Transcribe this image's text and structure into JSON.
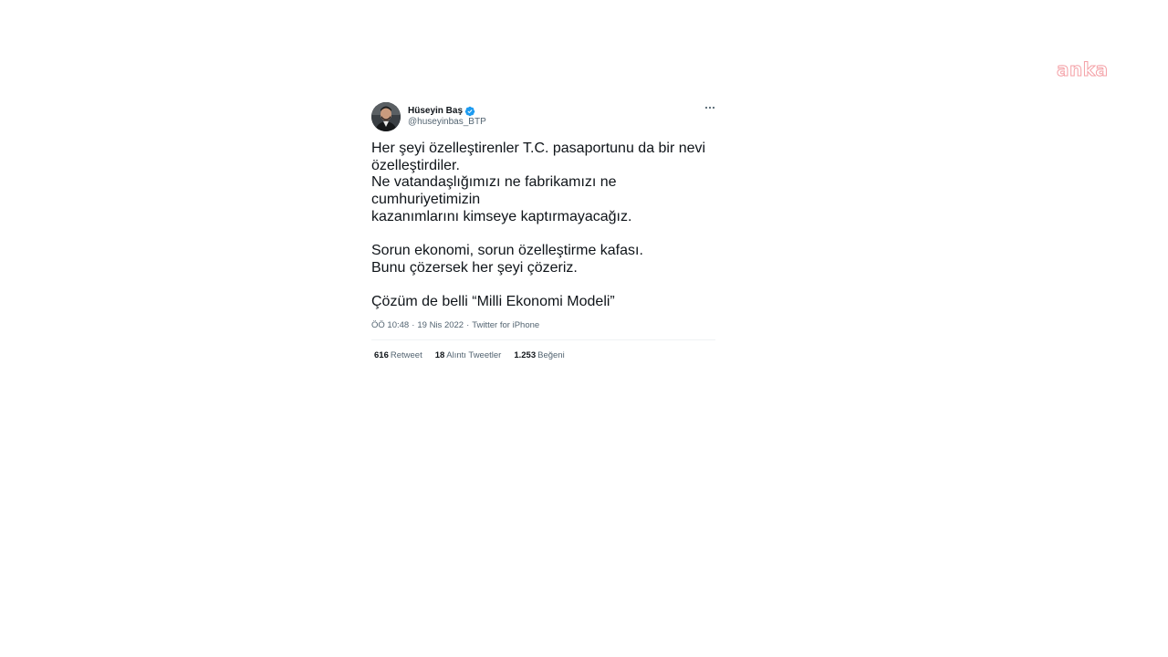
{
  "watermark": {
    "text": "anka",
    "color": "#f4a0a6"
  },
  "tweet": {
    "author": {
      "name": "Hüseyin Baş",
      "handle": "@huseyinbas_BTP",
      "verified": true
    },
    "more_icon": "more-dots-icon",
    "text": {
      "line1": "Her şeyi özelleştirenler T.C. pasaportunu da bir nevi",
      "line2": "özelleştirdiler.",
      "line3": "Ne vatandaşlığımızı ne fabrikamızı ne cumhuriyetimizin",
      "line4": "kazanımlarını kimseye kaptırmayacağız.",
      "line5": "Sorun ekonomi, sorun özelleştirme kafası.",
      "line6": "Bunu çözersek her şeyi çözeriz.",
      "line7": "Çözüm de belli “Milli Ekonomi Modeli”"
    },
    "meta": {
      "time": "ÖÖ 10:48",
      "date": "19 Nis 2022",
      "source": "Twitter for iPhone",
      "separator": "·"
    },
    "stats": {
      "retweets": {
        "count": "616",
        "label": "Retweet"
      },
      "quotes": {
        "count": "18",
        "label": "Alıntı Tweetler"
      },
      "likes": {
        "count": "1.253",
        "label": "Beğeni"
      }
    }
  },
  "colors": {
    "text_primary": "#0f1419",
    "text_secondary": "#536471",
    "verified_blue": "#1d9bf0",
    "divider": "#eff3f4"
  }
}
